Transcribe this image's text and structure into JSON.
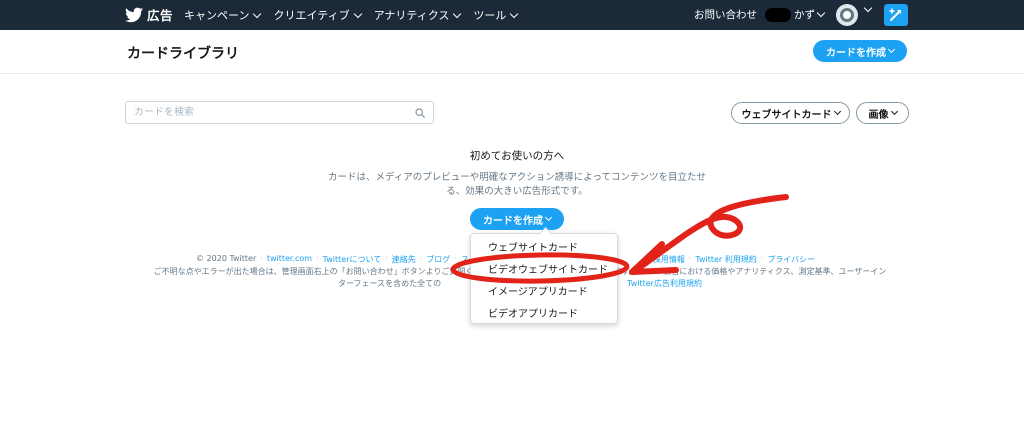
{
  "nav": {
    "brand": "広告",
    "menu": [
      {
        "label": "キャンペーン"
      },
      {
        "label": "クリエイティブ"
      },
      {
        "label": "アナリティクス"
      },
      {
        "label": "ツール"
      }
    ],
    "help": "お問い合わせ",
    "account_fragment": "かず"
  },
  "header": {
    "title": "カードライブラリ",
    "create_button": "カードを作成"
  },
  "filters": {
    "search_placeholder": "カードを検索",
    "search_value": "",
    "type_filter": "ウェブサイトカード",
    "format_filter": "画像"
  },
  "empty_state": {
    "title": "初めてお使いの方へ",
    "description": "カードは、メディアのプレビューや明確なアクション誘導によってコンテンツを目立たせる、効果の大きい広告形式です。",
    "cta": "カードを作成"
  },
  "footer": {
    "copyright": "© 2020 Twitter",
    "links_left": [
      "twitter.com",
      "Twitterについて",
      "連絡先",
      "ブログ",
      "ス"
    ],
    "links_right": [
      "採用情報",
      "Twitter 利用規約",
      "プライバシー"
    ],
    "notice_line1_start": "ご不明な点やエラーが出た場合は、管理画面右上の「お問い合わせ」ボタンよりご質問くださ",
    "notice_line1_end": "ます。Twitter広告における価格やアナリティクス、測定基準、ユーザーイン",
    "notice_line2_start": "ターフェースを含めた全ての",
    "notice_link": "Twitter広告利用規約"
  },
  "dropdown": {
    "items": [
      {
        "label": "ウェブサイトカード"
      },
      {
        "label": "ビデオウェブサイトカード"
      },
      {
        "label": "イメージアプリカード"
      },
      {
        "label": "ビデオアプリカード"
      }
    ]
  },
  "colors": {
    "nav_bg": "#1c2938",
    "accent": "#1da1f2",
    "annotation": "#e2231a"
  }
}
